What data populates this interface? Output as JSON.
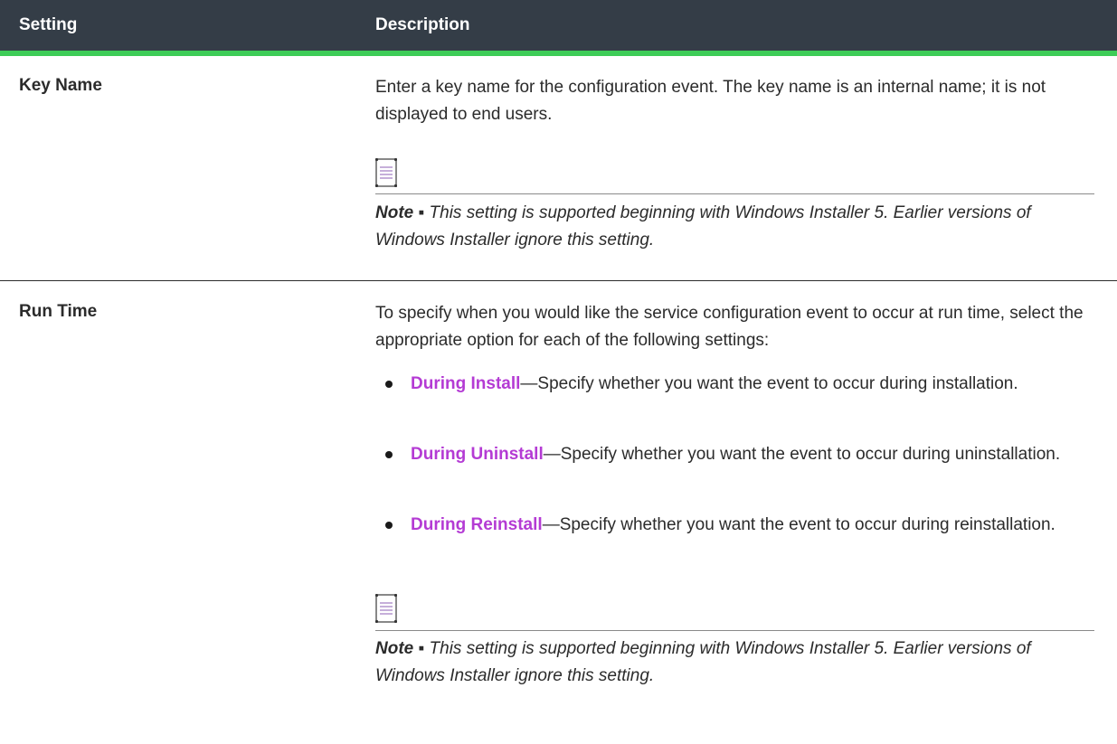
{
  "header": {
    "setting": "Setting",
    "description": "Description"
  },
  "rows": [
    {
      "setting": "Key Name",
      "description": "Enter a key name for the configuration event. The key name is an internal name; it is not displayed to end users.",
      "note": {
        "label": "Note ▪",
        "text": "This setting is supported beginning with Windows Installer 5. Earlier versions of Windows Installer ignore this setting."
      }
    },
    {
      "setting": "Run Time",
      "description": "To specify when you would like the service configuration event to occur at run time, select the appropriate option for each of the following settings:",
      "bullets": [
        {
          "link": "During Install",
          "text": "—Specify whether you want the event to occur during installation."
        },
        {
          "link": "During Uninstall",
          "text": "—Specify whether you want the event to occur during uninstallation."
        },
        {
          "link": "During Reinstall",
          "text": "—Specify whether you want the event to occur during reinstallation."
        }
      ],
      "note": {
        "label": "Note ▪",
        "text": "This setting is supported beginning with Windows Installer 5. Earlier versions of Windows Installer ignore this setting."
      }
    }
  ],
  "icons": {
    "note": "note-icon"
  },
  "colors": {
    "header_bg": "#343d47",
    "header_accent": "#3ecc57",
    "link": "#b43bd4"
  }
}
